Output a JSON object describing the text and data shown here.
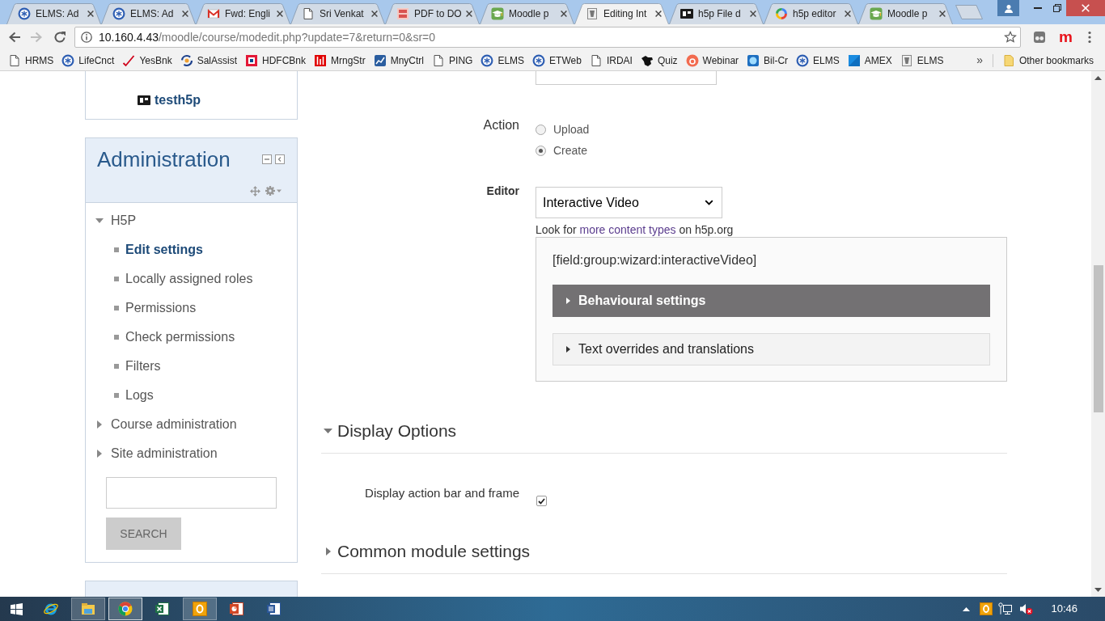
{
  "browser": {
    "tabs": [
      {
        "title": "ELMS: Ad",
        "selected": false
      },
      {
        "title": "ELMS: Ad",
        "selected": false
      },
      {
        "title": "Fwd: Engli",
        "selected": false
      },
      {
        "title": "Sri Venkat",
        "selected": false
      },
      {
        "title": "PDF to DO",
        "selected": false
      },
      {
        "title": "Moodle p",
        "selected": false
      },
      {
        "title": "Editing Int",
        "selected": true
      },
      {
        "title": "h5p File d",
        "selected": false
      },
      {
        "title": "h5p editor",
        "selected": false
      },
      {
        "title": "Moodle p",
        "selected": false
      }
    ],
    "back": {
      "disabled": false
    },
    "forward": {
      "disabled": true
    },
    "address": {
      "host": "10.160.4.43",
      "path": "/moodle/course/modedit.php?update=7&return=0&sr=0"
    },
    "extension_letter": "m",
    "bookmarks": [
      "HRMS",
      "LifeCnct",
      "YesBnk",
      "SalAssist",
      "HDFCBnk",
      "MrngStr",
      "MnyCtrl",
      "PING",
      "ELMS",
      "ETWeb",
      "IRDAI",
      "Quiz",
      "Webinar",
      "Bil-Cr",
      "ELMS",
      "AMEX",
      "ELMS"
    ],
    "bookmarks_overflow": "»",
    "other_bookmarks": "Other bookmarks"
  },
  "sidebar": {
    "navigation": [
      {
        "label": "testh5p",
        "selected": true
      }
    ],
    "administration": {
      "title": "Administration",
      "tree": [
        {
          "label": "H5P",
          "expanded": true,
          "children": [
            {
              "label": "Edit settings",
              "selected": true
            },
            {
              "label": "Locally assigned roles",
              "selected": false
            },
            {
              "label": "Permissions",
              "selected": false
            },
            {
              "label": "Check permissions",
              "selected": false
            },
            {
              "label": "Filters",
              "selected": false
            },
            {
              "label": "Logs",
              "selected": false
            }
          ]
        },
        {
          "label": "Course administration",
          "expanded": false
        },
        {
          "label": "Site administration",
          "expanded": false
        }
      ],
      "search_button": "SEARCH"
    }
  },
  "form": {
    "action": {
      "label": "Action",
      "options": [
        {
          "label": "Upload",
          "selected": false
        },
        {
          "label": "Create",
          "selected": true
        }
      ]
    },
    "editor": {
      "label": "Editor",
      "value": "Interactive Video",
      "hint_before": "Look for",
      "hint_link": "more content types",
      "hint_after": "on h5p.org"
    },
    "h5p": {
      "field_text": "[field:group:wizard:interactiveVideo]",
      "groups": [
        {
          "label": "Behavioural settings",
          "selected": true,
          "expanded": false
        },
        {
          "label": "Text overrides and translations",
          "selected": false,
          "expanded": false
        }
      ]
    },
    "sections": [
      {
        "title": "Display Options",
        "expanded": true,
        "fields": [
          {
            "label": "Display action bar and frame",
            "checked": true
          }
        ]
      },
      {
        "title": "Common module settings",
        "expanded": false
      }
    ]
  },
  "taskbar": {
    "apps": [
      {
        "open": false,
        "selected": false
      },
      {
        "open": true,
        "selected": false
      },
      {
        "open": true,
        "selected": true
      },
      {
        "open": false,
        "selected": false
      },
      {
        "open": true,
        "selected": false
      },
      {
        "open": false,
        "selected": false
      },
      {
        "open": false,
        "selected": false
      }
    ],
    "time": "10:46"
  }
}
